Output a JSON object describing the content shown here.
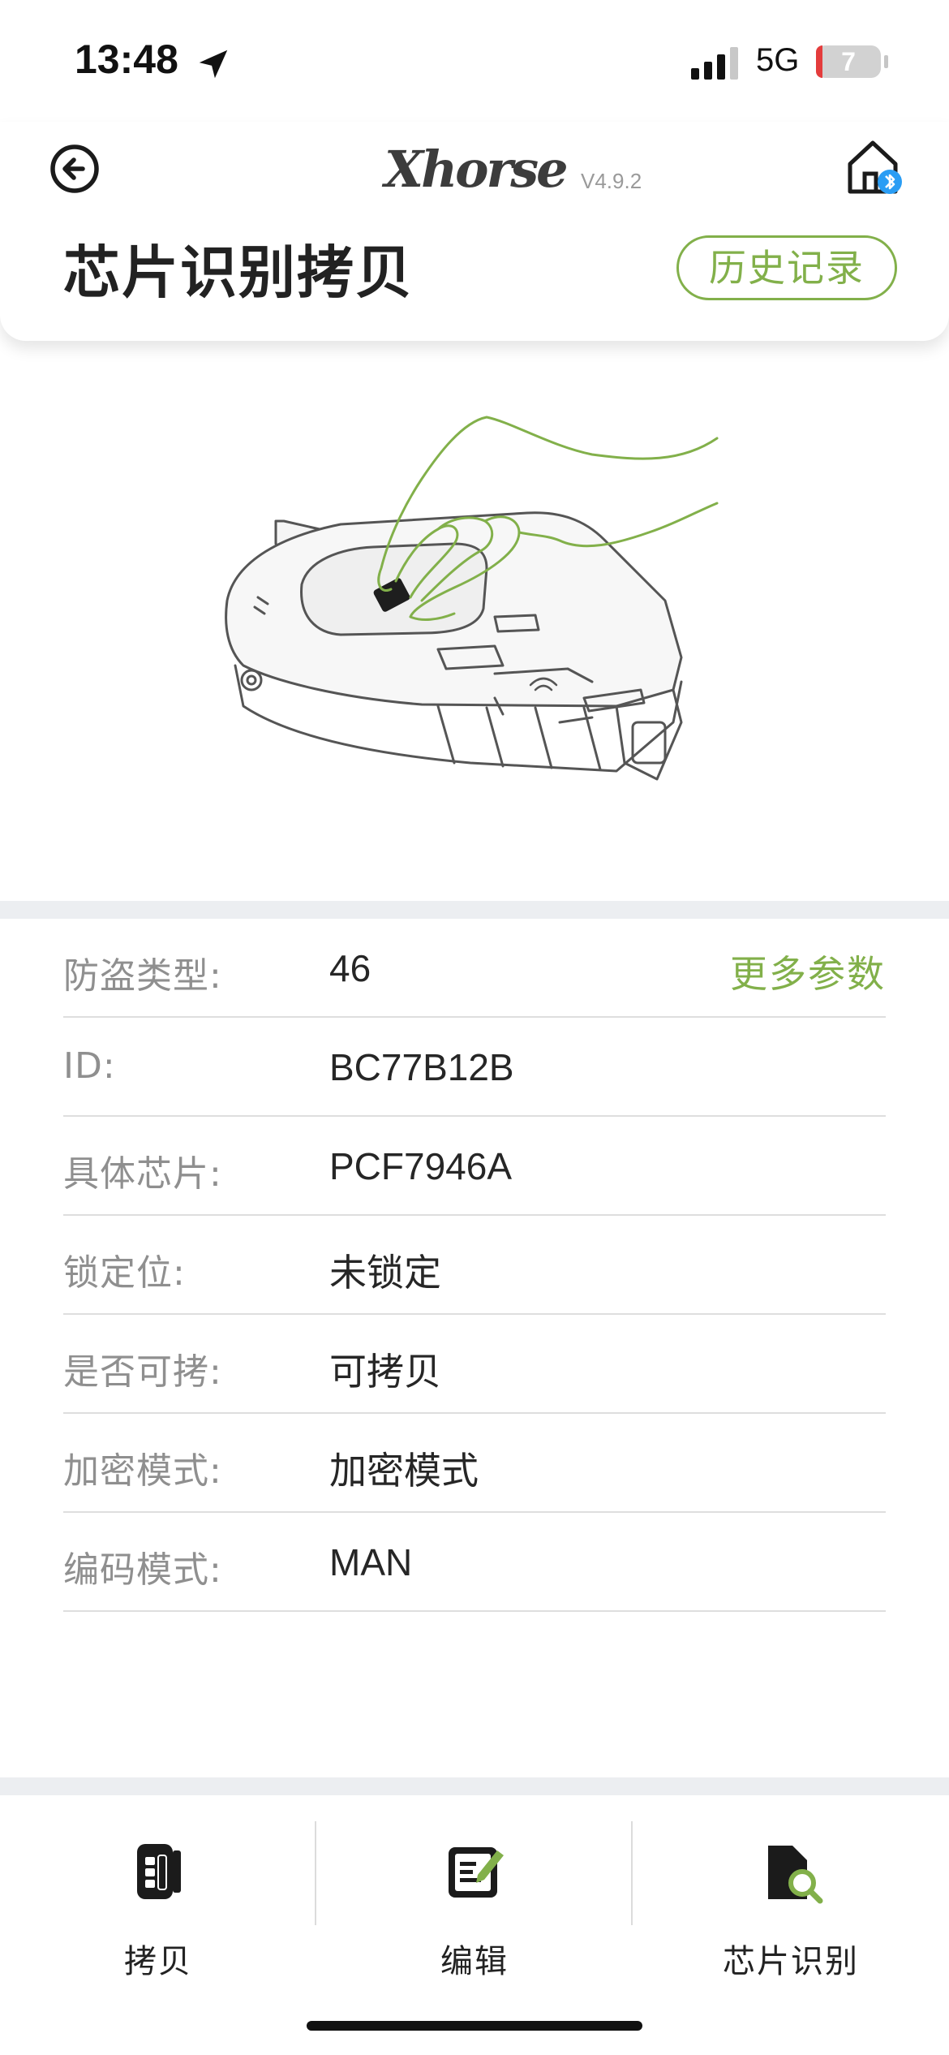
{
  "status_bar": {
    "time": "13:48",
    "network": "5G",
    "battery_level": "7",
    "battery_fraction": 0.07
  },
  "header": {
    "logo": "Xhorse",
    "version": "V4.9.2",
    "title": "芯片识别拷贝",
    "history_button": "历史记录"
  },
  "icons": {
    "back": "back-arrow-circle-icon",
    "home": "home-bluetooth-icon",
    "location": "location-arrow-icon"
  },
  "colors": {
    "accent": "#82b04a",
    "bluetooth": "#2a9df4",
    "band": "#eceef1"
  },
  "info": {
    "more_params": "更多参数",
    "rows": [
      {
        "label": "防盗类型:",
        "value": "46"
      },
      {
        "label": "ID:",
        "value": "BC77B12B"
      },
      {
        "label": "具体芯片:",
        "value": "PCF7946A"
      },
      {
        "label": "锁定位:",
        "value": "未锁定"
      },
      {
        "label": "是否可拷:",
        "value": "可拷贝"
      },
      {
        "label": "加密模式:",
        "value": "加密模式"
      },
      {
        "label": "编码模式:",
        "value": "MAN"
      }
    ]
  },
  "tabbar": {
    "tabs": [
      {
        "label": "拷贝",
        "icon": "key-fob-icon"
      },
      {
        "label": "编辑",
        "icon": "edit-document-icon"
      },
      {
        "label": "芯片识别",
        "icon": "chip-search-icon"
      }
    ]
  }
}
